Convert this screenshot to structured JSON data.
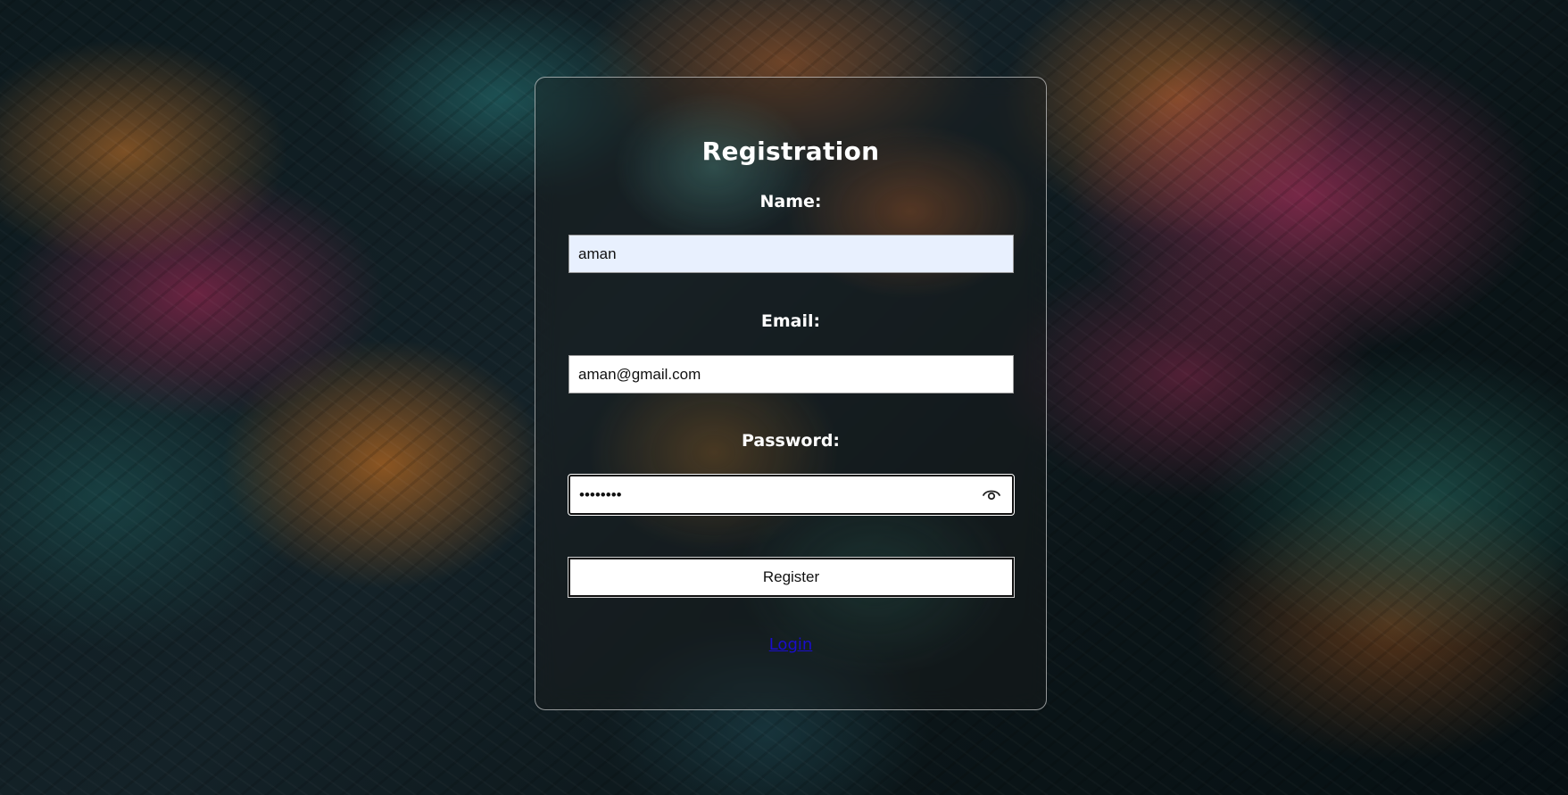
{
  "form": {
    "title": "Registration",
    "name_label": "Name:",
    "name_value": "aman",
    "email_label": "Email:",
    "email_value": "aman@gmail.com",
    "password_label": "Password:",
    "password_value": "••••••••",
    "password_toggle_icon": "eye-icon",
    "register_label": "Register",
    "login_link": "Login"
  },
  "colors": {
    "autofill_background": "#e8f0fe",
    "link": "#1a0dcc",
    "text_on_card": "#ffffff"
  }
}
